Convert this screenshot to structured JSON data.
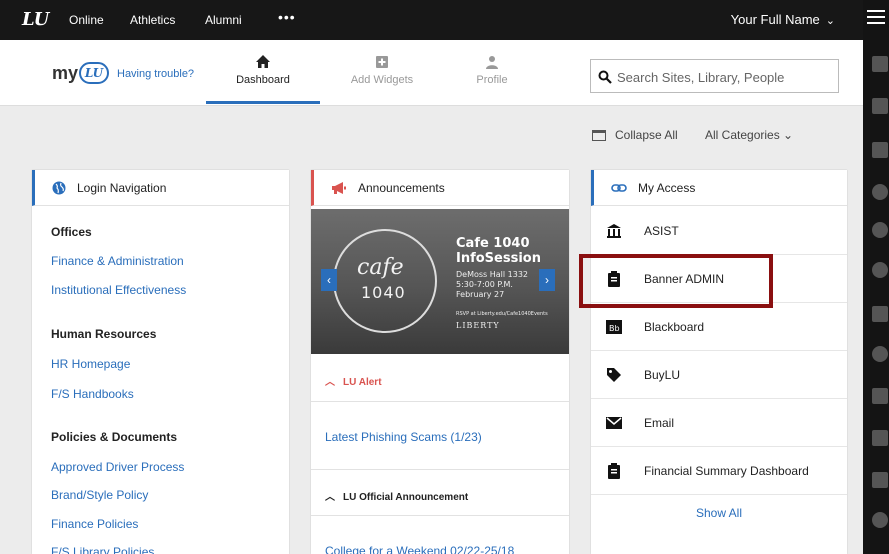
{
  "colors": {
    "accent": "#2a6ebb",
    "alert_red": "#d9534f",
    "highlight": "#8a0f10"
  },
  "topbar": {
    "logo": "LU",
    "nav": [
      "Online",
      "Athletics",
      "Alumni"
    ],
    "more": "•••",
    "user_name": "Your Full Name",
    "user_chevron": "⌄"
  },
  "header": {
    "brand_my": "my",
    "brand_lu": "LU",
    "trouble": "Having trouble?",
    "tabs": [
      {
        "label": "Dashboard",
        "icon": "home-icon"
      },
      {
        "label": "Add Widgets",
        "icon": "add-widget-icon"
      },
      {
        "label": "Profile",
        "icon": "person-icon"
      }
    ],
    "search_placeholder": "Search Sites, Library, People"
  },
  "toolbar": {
    "collapse_all": "Collapse All",
    "all_categories": "All Categories ⌄"
  },
  "login_nav": {
    "title": "Login Navigation",
    "sections": [
      {
        "heading": "Offices",
        "links": [
          "Finance & Administration",
          "Institutional Effectiveness"
        ]
      },
      {
        "heading": "Human Resources",
        "links": [
          "HR Homepage",
          "F/S Handbooks"
        ]
      },
      {
        "heading": "Policies & Documents",
        "links": [
          "Approved Driver Process",
          "Brand/Style Policy",
          "Finance Policies",
          "F/S Library Policies"
        ]
      }
    ]
  },
  "announcements": {
    "title": "Announcements",
    "banner": {
      "cafe": "cafe",
      "num": "1040",
      "title1": "Cafe 1040",
      "title2": "InfoSession",
      "line1": "DeMoss Hall 1332",
      "line2": "5:30-7:00 P.M.",
      "line3": "February 27",
      "small": "RSVP at Liberty.edu/Cafe1040Events",
      "liberty": "LIBERTY"
    },
    "alert_heading": "LU Alert",
    "alert_link": "Latest Phishing Scams (1/23)",
    "official_heading": "LU Official Announcement",
    "official_link": "College for a Weekend 02/22-25/18"
  },
  "my_access": {
    "title": "My Access",
    "items": [
      {
        "label": "ASIST",
        "icon": "bank-icon"
      },
      {
        "label": "Banner ADMIN",
        "icon": "clipboard-icon"
      },
      {
        "label": "Blackboard",
        "icon": "blackboard-icon"
      },
      {
        "label": "BuyLU",
        "icon": "tag-icon"
      },
      {
        "label": "Email",
        "icon": "envelope-icon"
      },
      {
        "label": "Financial Summary Dashboard",
        "icon": "clipboard-icon"
      }
    ],
    "show_all": "Show All"
  }
}
